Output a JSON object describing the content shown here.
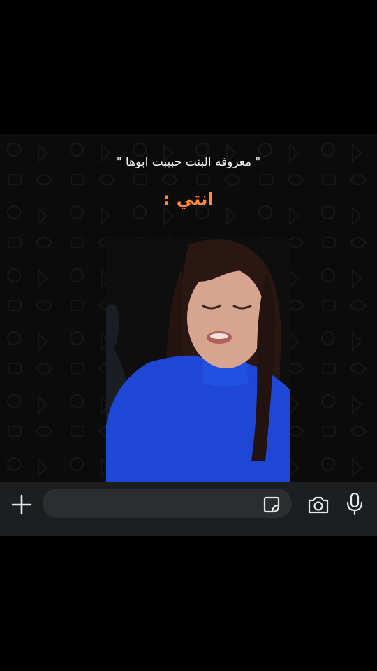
{
  "caption": {
    "main": "\" معروفه البنت حبيبت ابوها \"",
    "sub": "انتي :"
  },
  "composer": {
    "input_value": "",
    "icons": {
      "attach": "plus-icon",
      "sticker": "sticker-icon",
      "camera": "camera-icon",
      "voice": "microphone-icon"
    }
  },
  "colors": {
    "background": "#000000",
    "chat_wallpaper": "#0b0b0b",
    "caption_text": "#f1f1f1",
    "highlight_text": "#ff8a3d",
    "input_bar": "#1d1e20",
    "input_field": "#2c2d30",
    "icon": "#e8e8e8",
    "shirt_blue": "#1f47d6"
  }
}
